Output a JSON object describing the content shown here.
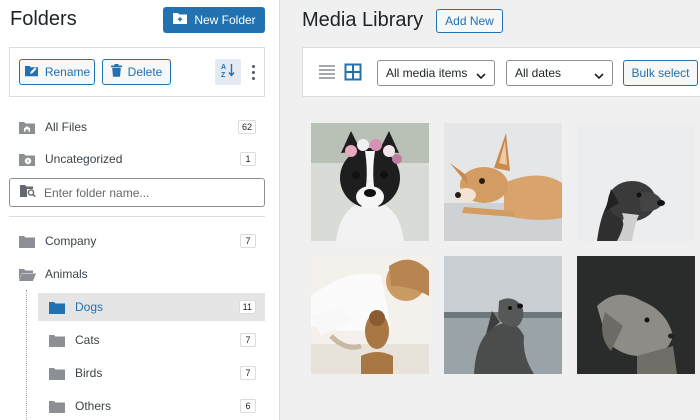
{
  "folders_panel": {
    "title": "Folders",
    "new_folder_label": "New Folder",
    "rename_label": "Rename",
    "delete_label": "Delete",
    "input_placeholder": "Enter folder name...",
    "items": [
      {
        "label": "All Files",
        "count": "62"
      },
      {
        "label": "Uncategorized",
        "count": "1"
      },
      {
        "label": "Company",
        "count": "7"
      },
      {
        "label": "Animals",
        "count": ""
      },
      {
        "label": "Dogs",
        "count": "11"
      },
      {
        "label": "Cats",
        "count": "7"
      },
      {
        "label": "Birds",
        "count": "7"
      },
      {
        "label": "Others",
        "count": "6"
      }
    ],
    "active_folder": "Dogs"
  },
  "media": {
    "title": "Media Library",
    "add_new_label": "Add New",
    "filter_type": "All media items",
    "filter_date": "All dates",
    "bulk_select_label": "Bulk select",
    "view_mode": "grid"
  },
  "colors": {
    "accent": "#2271b1",
    "background": "#f0f0f1",
    "text": "#1d2327"
  }
}
